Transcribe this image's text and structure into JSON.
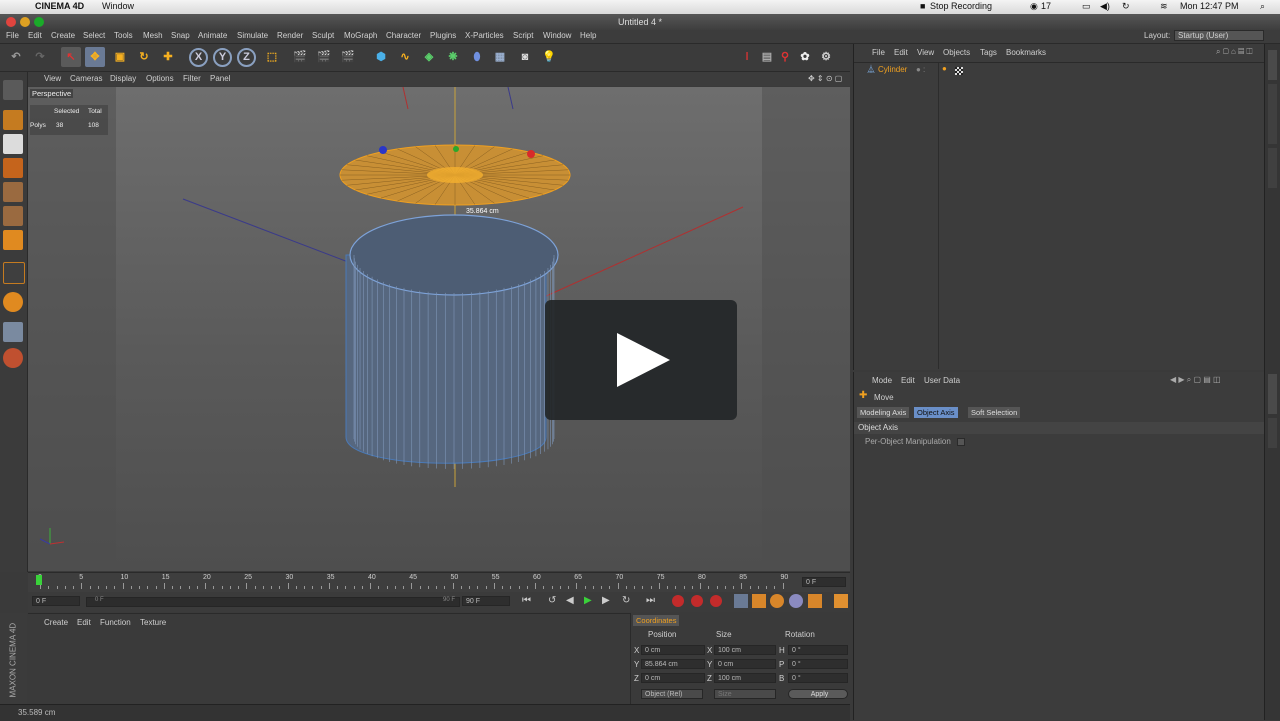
{
  "mac_menubar": {
    "app": "CINEMA 4D",
    "window": "Window",
    "stop_recording": "Stop Recording",
    "badge": "17",
    "clock": "Mon 12:47 PM"
  },
  "window_title": "Untitled 4 *",
  "c4d_menu": [
    "File",
    "Edit",
    "Create",
    "Select",
    "Tools",
    "Mesh",
    "Snap",
    "Animate",
    "Simulate",
    "Render",
    "Sculpt",
    "MoGraph",
    "Character",
    "Plugins",
    "X-Particles",
    "Script",
    "Window",
    "Help"
  ],
  "layout": {
    "label": "Layout:",
    "value": "Startup (User)"
  },
  "toolbar_axis": [
    "X",
    "Y",
    "Z"
  ],
  "viewport": {
    "menu": [
      "View",
      "Cameras",
      "Display",
      "Options",
      "Filter",
      "Panel"
    ],
    "camera_label": "Perspective",
    "stats_headers": [
      "Selected",
      "Total"
    ],
    "stats_label": "Polys",
    "stats_selected": "38",
    "stats_total": "108",
    "measure_label": "35.864 cm"
  },
  "timeline": {
    "ticks": [
      "0",
      "5",
      "10",
      "15",
      "20",
      "25",
      "30",
      "35",
      "40",
      "45",
      "50",
      "55",
      "60",
      "65",
      "70",
      "75",
      "80",
      "85",
      "90"
    ],
    "current_frame": "0 F"
  },
  "transport": {
    "start": "0 F",
    "slider_start": "0 F",
    "slider_end": "90 F",
    "end": "90 F"
  },
  "material_menu": [
    "Create",
    "Edit",
    "Function",
    "Texture"
  ],
  "coordinates": {
    "tab": "Coordinates",
    "headers": [
      "Position",
      "Size",
      "Rotation"
    ],
    "rows": [
      {
        "axis": "X",
        "pos": "0 cm",
        "size_axis": "X",
        "size": "100 cm",
        "rot_axis": "H",
        "rot": "0 °"
      },
      {
        "axis": "Y",
        "pos": "85.864 cm",
        "size_axis": "Y",
        "size": "0 cm",
        "rot_axis": "P",
        "rot": "0 °"
      },
      {
        "axis": "Z",
        "pos": "0 cm",
        "size_axis": "Z",
        "size": "100 cm",
        "rot_axis": "B",
        "rot": "0 °"
      }
    ],
    "mode": "Object (Rel)",
    "size_mode": "Size",
    "apply": "Apply"
  },
  "status": "35.589 cm",
  "objects_panel": {
    "menu": [
      "File",
      "Edit",
      "View",
      "Objects",
      "Tags",
      "Bookmarks"
    ],
    "object_name": "Cylinder"
  },
  "attributes_panel": {
    "menu": [
      "Mode",
      "Edit",
      "User Data"
    ],
    "tool_name": "Move",
    "tabs": [
      "Modeling Axis",
      "Object Axis",
      "Soft Selection"
    ],
    "section": "Object Axis",
    "option": "Per-Object Manipulation"
  },
  "brand": "MAXON CINEMA 4D",
  "colors": {
    "accent_orange": "#f0a020",
    "selection_blue": "#4a7ab8",
    "mesh_blue": "#566c88"
  }
}
